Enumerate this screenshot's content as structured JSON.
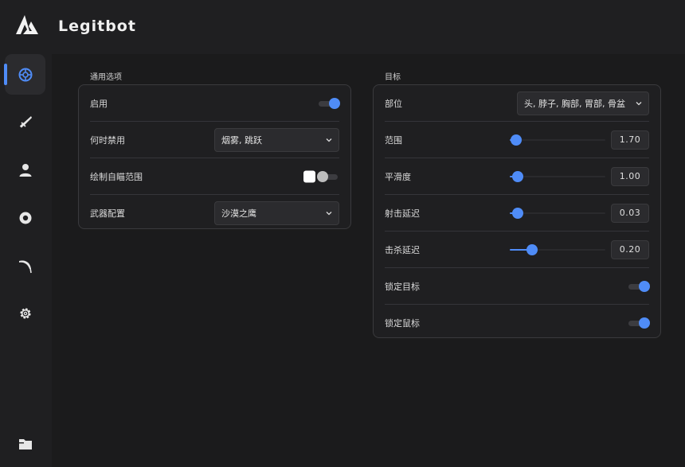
{
  "app": {
    "title": "Legitbot",
    "logo_icon": "triangle-logo-icon",
    "accent": "#4f8cf7"
  },
  "sidebar": {
    "items": [
      {
        "icon": "target-icon",
        "active": true
      },
      {
        "icon": "knife-icon",
        "active": false
      },
      {
        "icon": "user-icon",
        "active": false
      },
      {
        "icon": "eye-icon",
        "active": false
      },
      {
        "icon": "scythe-icon",
        "active": false
      },
      {
        "icon": "gear-icon",
        "active": false
      },
      {
        "icon": "folder-icon",
        "active": false
      }
    ]
  },
  "general": {
    "section_title": "通用选项",
    "enable": {
      "label": "启用",
      "on": true
    },
    "disable_when": {
      "label": "何时禁用",
      "value": "烟雾, 跳跃"
    },
    "draw_fov": {
      "label": "绘制自瞄范围",
      "color": "#ffffff",
      "on": false
    },
    "weapon_config": {
      "label": "武器配置",
      "value": "沙漠之鹰"
    }
  },
  "target": {
    "section_title": "目标",
    "hitbox": {
      "label": "部位",
      "value": "头, 脖子, 胸部, 胃部, 骨盆"
    },
    "fov": {
      "label": "范围",
      "value": "1.70",
      "fraction": 0.07
    },
    "smooth": {
      "label": "平滑度",
      "value": "1.00",
      "fraction": 0.08
    },
    "shot_delay": {
      "label": "射击延迟",
      "value": "0.03",
      "fraction": 0.08
    },
    "kill_delay": {
      "label": "击杀延迟",
      "value": "0.20",
      "fraction": 0.23
    },
    "lock_target": {
      "label": "锁定目标",
      "on": true
    },
    "lock_mouse": {
      "label": "锁定鼠标",
      "on": true
    }
  }
}
